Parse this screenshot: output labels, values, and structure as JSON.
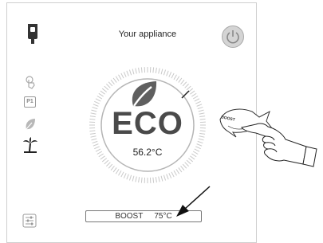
{
  "header": {
    "title": "Your appliance"
  },
  "icons": {
    "appliance": "water-heater-icon",
    "power": "power-icon",
    "touch": "touch-hand-icon",
    "program": "p1-program-icon",
    "eco": "leaf-icon",
    "holiday": "palm-tree-icon",
    "settings": "sliders-icon"
  },
  "side_menu": {
    "program_label": "P1"
  },
  "dial": {
    "mode": "ECO",
    "temperature": "56.2°C"
  },
  "boost_bar": {
    "label": "BOOST",
    "temperature": "75°C"
  },
  "boost_button": {
    "label": "BOOST"
  },
  "colors": {
    "accent": "#b0b0b0",
    "text": "#4a4a4a",
    "leaf": "#6b6b6b"
  }
}
